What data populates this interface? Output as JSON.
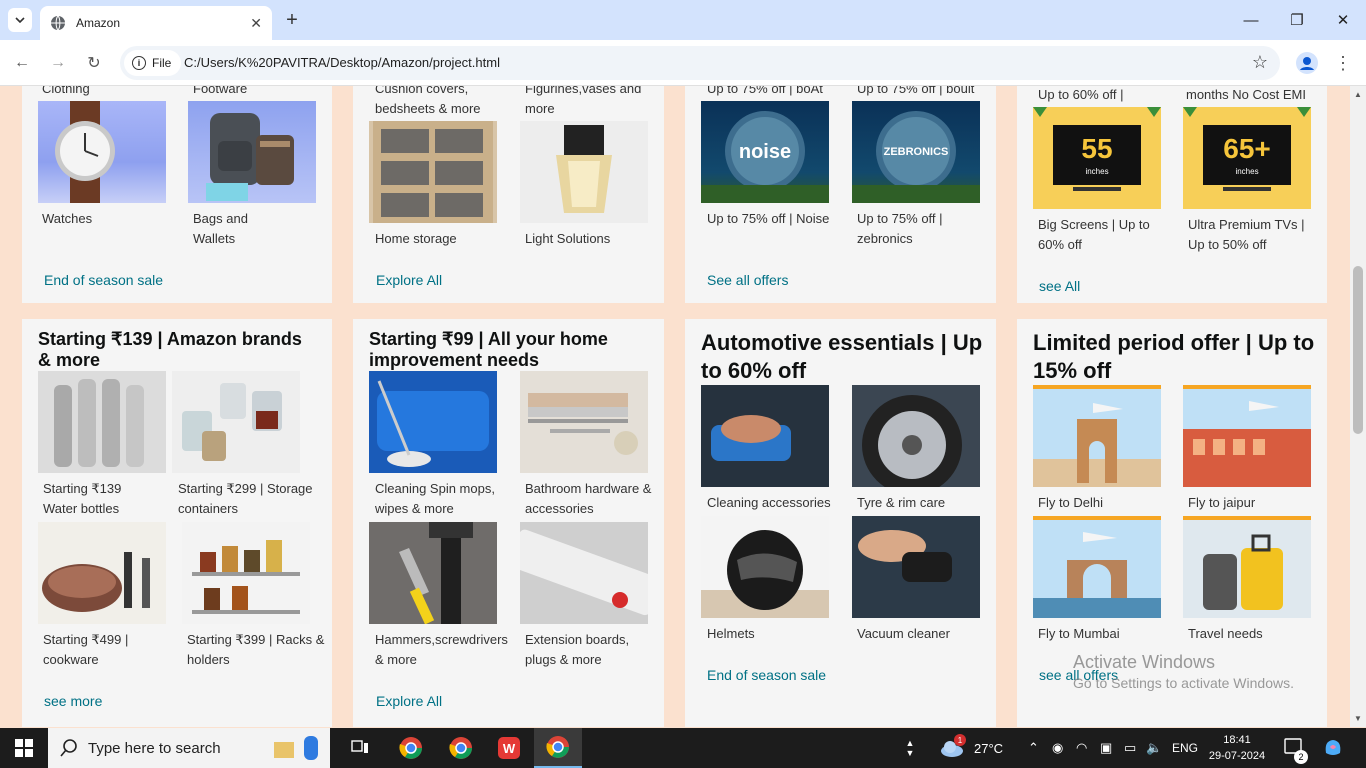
{
  "browser": {
    "tab_title": "Amazon",
    "scheme_label": "File",
    "url": "C:/Users/K%20PAVITRA/Desktop/Amazon/project.html"
  },
  "cards_top": [
    {
      "items": [
        {
          "label_top": "Clothing",
          "caption": "Watches"
        },
        {
          "label_top": "Footware",
          "caption": "Bags and Wallets"
        }
      ],
      "link": "End of season sale"
    },
    {
      "items": [
        {
          "label_top": "Cushion covers, bedsheets & more",
          "caption": "Home storage"
        },
        {
          "label_top": "Figurines,vases and more",
          "caption": "Light Solutions"
        }
      ],
      "link": "Explore All"
    },
    {
      "items": [
        {
          "label_top": "Up to 75% off | boAt",
          "caption": "Up to 75% off | Noise",
          "brand": "noise"
        },
        {
          "label_top": "Up to 75% off | boult",
          "caption": "Up to 75% off | zebronics",
          "brand": "ZEBRONICS"
        }
      ],
      "link": "See all offers"
    },
    {
      "items": [
        {
          "label_top": "Up to 60% off |",
          "caption": "Big Screens | Up to 60% off",
          "screen": "55",
          "unit": "inches"
        },
        {
          "label_top": "months No Cost EMI",
          "caption": "Ultra Premium TVs | Up to 50% off",
          "screen": "65+",
          "unit": "inches"
        }
      ],
      "link": "see All"
    }
  ],
  "cards_bottom": [
    {
      "title": "Starting ₹139 | Amazon brands & more",
      "items": [
        "Starting ₹139 Water bottles",
        "Starting ₹299 | Storage containers",
        "Starting ₹499 | cookware",
        "Starting ₹399 | Racks & holders"
      ],
      "link": "see more"
    },
    {
      "title": "Starting ₹99 | All your home improvement needs",
      "items": [
        "Cleaning Spin mops, wipes & more",
        "Bathroom hardware & accessories",
        "Hammers,screwdrivers & more",
        "Extension boards, plugs & more"
      ],
      "link": "Explore All"
    },
    {
      "title": "Automotive essentials | Up to 60% off",
      "items": [
        "Cleaning accessories",
        "Tyre & rim care",
        "Helmets",
        "Vacuum cleaner"
      ],
      "link": "End of season sale"
    },
    {
      "title": "Limited period offer | Up to 15% off",
      "items": [
        "Fly to Delhi",
        "Fly to jaipur",
        "Fly to Mumbai",
        "Travel needs"
      ],
      "link": "see all offers"
    }
  ],
  "watermark": {
    "line1": "Activate Windows",
    "line2": "Go to Settings to activate Windows."
  },
  "taskbar": {
    "search_placeholder": "Type here to search",
    "weather": "27°C",
    "weather_badge": "1",
    "lang": "ENG",
    "time": "18:41",
    "date": "29-07-2024",
    "notif": "2"
  },
  "colors": {
    "page_bg": "#fbe1cf",
    "card_bg": "#f5f5f5",
    "link": "#007185",
    "accent": "#f6a623"
  }
}
